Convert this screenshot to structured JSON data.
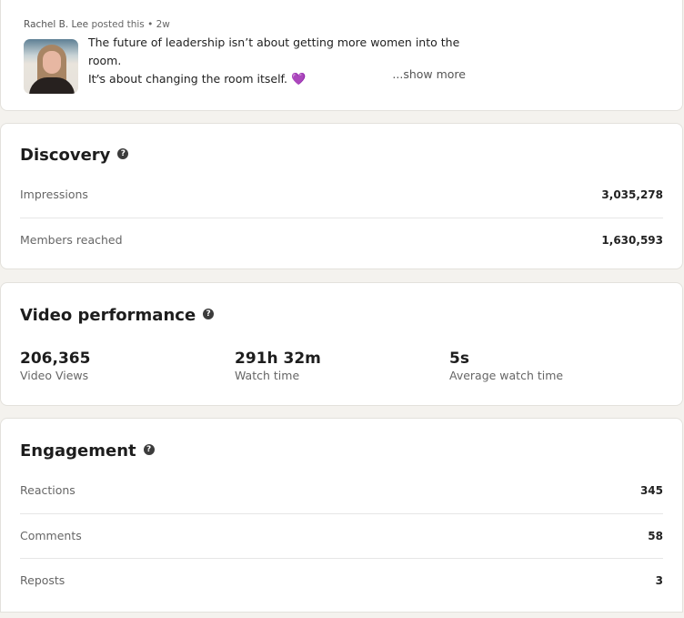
{
  "post": {
    "author": "Rachel B. Lee",
    "meta_suffix": " posted this • 2w",
    "line1": "The future of leadership isn’t about getting more women into the room.",
    "line2": "It’s about changing the room itself.",
    "heart_icon": "💜",
    "ellipsis": "...",
    "show_more": "...show more"
  },
  "discovery": {
    "title": "Discovery",
    "help_icon": "?",
    "rows": [
      {
        "label": "Impressions",
        "value": "3,035,278"
      },
      {
        "label": "Members reached",
        "value": "1,630,593"
      }
    ]
  },
  "video": {
    "title": "Video performance",
    "help_icon": "?",
    "metrics": [
      {
        "value": "206,365",
        "label": "Video Views"
      },
      {
        "value": "291h 32m",
        "label": "Watch time"
      },
      {
        "value": "5s",
        "label": "Average watch time"
      }
    ]
  },
  "engagement": {
    "title": "Engagement",
    "help_icon": "?",
    "rows": [
      {
        "label": "Reactions",
        "value": "345"
      },
      {
        "label": "Comments",
        "value": "58"
      },
      {
        "label": "Reposts",
        "value": "3"
      }
    ]
  }
}
